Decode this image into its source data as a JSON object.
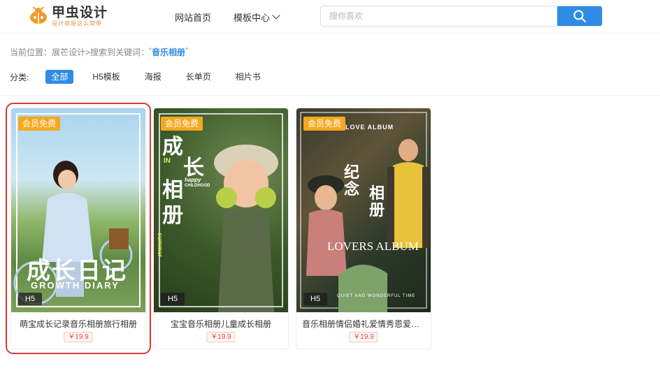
{
  "header": {
    "logo_title": "甲虫设计",
    "logo_sub": "设计就是这么简单",
    "nav_home": "网站首页",
    "nav_templates": "模板中心",
    "search_placeholder": "搜你喜欢"
  },
  "breadcrumb": {
    "prefix": "当前位置：",
    "site": "展芒设计",
    "sep": " >搜索到关键词：",
    "keyword_open": "“",
    "keyword": "音乐相册",
    "keyword_close": "”"
  },
  "filters": {
    "label": "分类:",
    "items": [
      "全部",
      "H5模板",
      "海报",
      "长单页",
      "相片书"
    ]
  },
  "cards": [
    {
      "badge": "会员免费",
      "type": "H5",
      "title": "萌宝成长记录音乐相册旅行相册",
      "price": "￥19.9",
      "poster_main": "成长日记",
      "poster_sub": "GROWTH DIARY"
    },
    {
      "badge": "会员免费",
      "type": "H5",
      "title": "宝宝音乐相册儿童成长相册",
      "price": "￥19.9",
      "poster_main1": "成",
      "poster_main2": "长",
      "poster_main3": "相",
      "poster_main4": "册",
      "poster_in": "IN",
      "poster_happy": "happy",
      "poster_child": "CHILDHOOD",
      "poster_summer": "summer"
    },
    {
      "badge": "会员免费",
      "type": "H5",
      "title": "音乐相册情侣婚礼爱情秀恩爱表...",
      "price": "￥19.9",
      "poster_top": "LOVE ALBUM",
      "poster_jinian": "纪念",
      "poster_xiangce": "相册",
      "poster_lovers": "LOVERS ALBUM",
      "poster_quiet": "QUIET AND WONDERFUL TIME"
    }
  ]
}
